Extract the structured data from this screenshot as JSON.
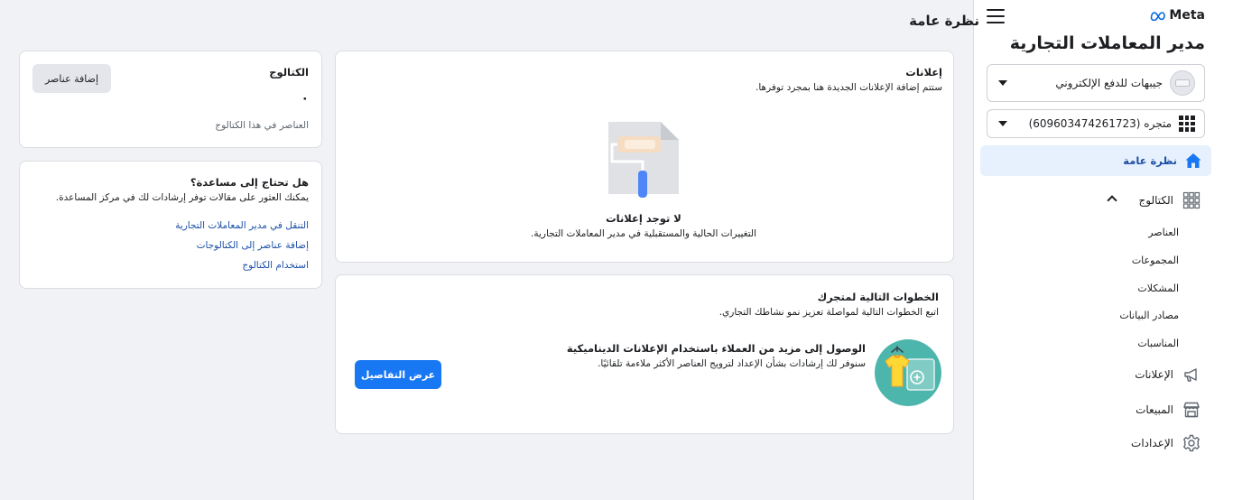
{
  "sidebar": {
    "brand": "Meta",
    "app_title": "مدير المعاملات التجارية",
    "business_select": "جيبهات للدفع الإلكتروني",
    "catalog_select": "متجره (609603474261723)",
    "nav": {
      "overview": "نظرة عامة",
      "catalog": "الكتالوج",
      "catalog_items": [
        "العناصر",
        "المجموعات",
        "المشكلات",
        "مصادر البيانات",
        "المناسبات"
      ],
      "ads": "الإعلانات",
      "sales": "المبيعات",
      "settings": "الإعدادات"
    }
  },
  "main": {
    "page_title": "نظرة عامة",
    "ads_card": {
      "title": "إعلانات",
      "subtitle": "ستتم إضافة الإعلانات الجديدة هنا بمجرد توفرها.",
      "empty_title": "لا توجد إعلانات",
      "empty_text": "التغييرات الحالية والمستقبلية في مدير المعاملات التجارية."
    },
    "next_steps_card": {
      "title": "الخطوات التالية لمتجرك",
      "subtitle": "اتبع الخطوات التالية لمواصلة تعزيز نمو نشاطك التجاري.",
      "item_title": "الوصول إلى مزيد من العملاء باستخدام الإعلانات الديناميكية",
      "item_text": "سنوفر لك إرشادات بشأن الإعداد لترويج العناصر الأكثر ملاءمة تلقائيًا.",
      "button": "عرض التفاصيل"
    },
    "catalog_card": {
      "title": "الكتالوج",
      "count": "٠",
      "count_label": "العناصر في هذا الكتالوج",
      "button": "إضافة عناصر"
    },
    "help_card": {
      "title": "هل تحتاج إلى مساعدة؟",
      "subtitle": "يمكنك العثور على مقالات توفر إرشادات لك في مركز المساعدة.",
      "links": [
        "التنقل في مدير المعاملات التجارية",
        "إضافة عناصر إلى الكتالوجات",
        "استخدام الكتالوج"
      ]
    }
  },
  "colors": {
    "accent": "#1877f2",
    "link": "#1b4fa6",
    "active_bg": "#e7f0fd",
    "page_bg": "#f0f2f5"
  }
}
